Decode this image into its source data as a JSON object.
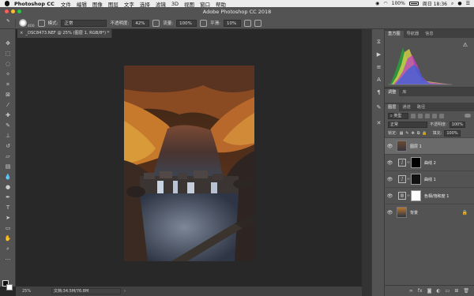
{
  "menubar": {
    "app": "Photoshop CC",
    "items": [
      "文件",
      "编辑",
      "图像",
      "图层",
      "文字",
      "选择",
      "滤镜",
      "3D",
      "视图",
      "窗口",
      "帮助"
    ],
    "battery": "100%",
    "clock": "周日 18:36"
  },
  "window": {
    "title": "Adobe Photoshop CC 2018"
  },
  "options": {
    "brush_size": "400",
    "mode_label": "模式:",
    "mode_value": "正常",
    "opacity_label": "不透明度:",
    "opacity_value": "42%",
    "flow_label": "流量:",
    "flow_value": "100%",
    "smooth_label": "平滑:",
    "smooth_value": "10%"
  },
  "document": {
    "tab_title": "_DSC8473.NEF @ 25% (图层 1, RGB/8*) *",
    "zoom": "25%",
    "doc_info": "文档:34.5M/76.8M"
  },
  "panels": {
    "top_tabs": [
      "直方图",
      "导航器",
      "信息"
    ],
    "adj_tabs": [
      "调整",
      "库"
    ],
    "layer_tabs": [
      "图层",
      "通道",
      "路径"
    ],
    "kind_label": "类型",
    "blend_mode": "正常",
    "opacity_label": "不透明度:",
    "opacity_value": "100%",
    "lock_label": "锁定:",
    "fill_label": "填充:",
    "fill_value": "100%"
  },
  "layers": [
    {
      "name": "图层 1",
      "selected": true,
      "kind": "pixel"
    },
    {
      "name": "曲线 2",
      "selected": false,
      "kind": "curves"
    },
    {
      "name": "曲线 1",
      "selected": false,
      "kind": "curves"
    },
    {
      "name": "色相/饱和度 1",
      "selected": false,
      "kind": "huesat"
    },
    {
      "name": "背景",
      "selected": false,
      "kind": "background"
    }
  ],
  "colors": {
    "foreground": "#111111",
    "background": "#ffffff",
    "panel_bg": "#535353",
    "canvas_bg": "#282828"
  }
}
